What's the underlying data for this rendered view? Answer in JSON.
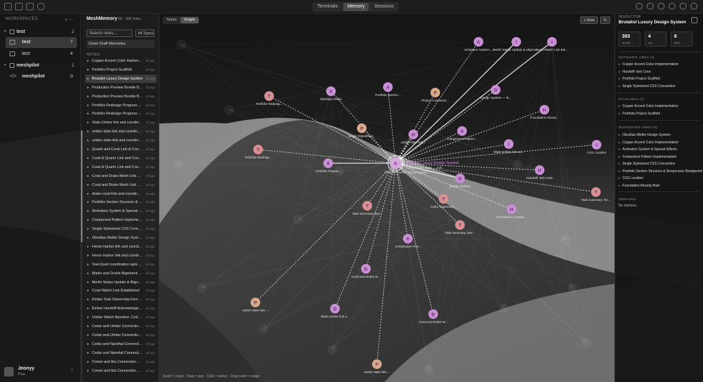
{
  "topbar": {
    "tabs": [
      {
        "label": "Terminals"
      },
      {
        "label": "Memory"
      },
      {
        "label": "Sessions"
      }
    ]
  },
  "workspaces": {
    "header": "WORKSPACES",
    "groups": [
      {
        "name": "test",
        "count": "2",
        "sessions": [
          {
            "name": "test",
            "count": "7"
          },
          {
            "name": "test",
            "count": "4"
          }
        ]
      },
      {
        "name": "meshpilot",
        "count": "1",
        "sessions": [
          {
            "name": "meshpilot",
            "count": "0"
          }
        ]
      }
    ],
    "user": {
      "name": "Jeonyy",
      "plan": "Plus"
    }
  },
  "notes_panel": {
    "title": "MeshMemory",
    "subtitle": "68 · 650 links",
    "search_placeholder": "Search notes...",
    "type_filter": "All Types",
    "clean_button": "Clean Draft Memories",
    "section": "NOTES",
    "items": [
      {
        "title": "Copper Accent Color Implement...",
        "age": "2d ago"
      },
      {
        "title": "Portfolio Project Scaffold",
        "age": "2d ago"
      },
      {
        "title": "Brutalist Luxury Design System",
        "age": "2d ago"
      },
      {
        "title": "Production Preview Bundle Buil...",
        "age": "2d ago"
      },
      {
        "title": "Production Preview Bundle Buil...",
        "age": "2d ago"
      },
      {
        "title": "Portfolio Redesign Progress — ...",
        "age": "2d ago"
      },
      {
        "title": "Portfolio Redesign Progress — ...",
        "age": "2d ago"
      },
      {
        "title": "Slate-Umber link and coordinati...",
        "age": "2d ago"
      },
      {
        "title": "umber slate link and coordinatio...",
        "age": "2d ago"
      },
      {
        "title": "umber-slate-link-and-coordinatio...",
        "age": "2d ago"
      },
      {
        "title": "Quartz and Coral Link & Coordi...",
        "age": "2d ago"
      },
      {
        "title": "Coral & Quartz Link and Coordi...",
        "age": "2d ago"
      },
      {
        "title": "Coral & Quartz Link and Coordi...",
        "age": "2d ago"
      },
      {
        "title": "Coral and Drake Mesh Link & 1...",
        "age": "2d ago"
      },
      {
        "title": "Coral and Drake Mesh Link & T...",
        "age": "2d ago"
      },
      {
        "title": "drake-coral-link-and-coordination",
        "age": "2d ago"
      },
      {
        "title": "Portfolio Section Structure & R...",
        "age": "2d ago"
      },
      {
        "title": "Animation System & Special Ef...",
        "age": "2d ago"
      },
      {
        "title": "Component Pattern Implementat...",
        "age": "2d ago"
      },
      {
        "title": "Single-Stylesheet CSS Conven...",
        "age": "2d ago"
      },
      {
        "title": "Obsidian Atelier Design System",
        "age": "2d ago"
      },
      {
        "title": "Heron-Harbor link and coordinati...",
        "age": "2d ago"
      },
      {
        "title": "Heron Harbor link and coordina...",
        "age": "2d ago"
      },
      {
        "title": "Teal-Quail coordination agreement",
        "age": "2d ago"
      },
      {
        "title": "Marlin and Ocelot Alignment  W...",
        "age": "2d ago"
      },
      {
        "title": "Merlin Status Update & Alignme...",
        "age": "2d ago"
      },
      {
        "title": "Coral Watch Link Established",
        "age": "2d ago"
      },
      {
        "title": "Ember Task Ownership from Me...",
        "age": "2d ago"
      },
      {
        "title": "Ember Handoff Acknowledged fr...",
        "age": "2d ago"
      },
      {
        "title": "Umber Watch Baseline: Cedar I...",
        "age": "2d ago"
      },
      {
        "title": "Cedar and Umber Connection E...",
        "age": "2d ago"
      },
      {
        "title": "Cedar and Umber Connection E...",
        "age": "2d ago"
      },
      {
        "title": "Cedar and Narwhal Connection ...",
        "age": "2d ago"
      },
      {
        "title": "Cedar and Narwhal Connection Esta...",
        "age": "2d ago"
      },
      {
        "title": "Comet and Ibis Connection Esta...",
        "age": "2d ago"
      },
      {
        "title": "Comet and Ibis Connection Esta...",
        "age": "2d ago"
      }
    ]
  },
  "graph": {
    "view_tabs": [
      {
        "label": "Notes"
      },
      {
        "label": "Graph"
      }
    ],
    "new_note_label": "+ Note",
    "hint": "Scroll = zoom · Drag = pan · Click = select · Drag node = nudge",
    "nodes": [
      {
        "letter": "A",
        "label": "Brutalist Luxury Design System",
        "color": "#d7a7e0",
        "center": true
      },
      {
        "letter": "A",
        "label": "Animation System ...",
        "color": "#c98fd4"
      },
      {
        "letter": "I",
        "label": "Merlin Status Update & Alignme...",
        "color": "#c98fd4"
      },
      {
        "letter": "I",
        "label": "Coral Watch Link Est...",
        "color": "#c98fd4"
      },
      {
        "letter": "A",
        "label": "Portfolio Section...",
        "color": "#c98fd4"
      },
      {
        "letter": "P",
        "label": "Project Connectio...",
        "color": "#d9a88a"
      },
      {
        "letter": "D",
        "label": "Design System — B...",
        "color": "#c98fd4"
      },
      {
        "letter": "A",
        "label": "Obsidian Atelier",
        "color": "#c98fd4"
      },
      {
        "letter": "T",
        "label": "Portfolio Redesig...",
        "color": "#d99090"
      },
      {
        "letter": "H",
        "label": "Foundation Alread...",
        "color": "#c98fd4"
      },
      {
        "letter": "P",
        "label": "Single-Stylesheet...",
        "color": "#d9a88a"
      },
      {
        "letter": "H",
        "label": "umber slate link...",
        "color": "#c98fd4"
      },
      {
        "letter": "A",
        "label": "Component Pattern...",
        "color": "#c98fd4"
      },
      {
        "letter": "I",
        "label": "Slate-Umber link an...",
        "color": "#c98fd4"
      },
      {
        "letter": "I",
        "label": "CSS Location",
        "color": "#c98fd4"
      },
      {
        "letter": "T",
        "label": "Portfolio Redesig...",
        "color": "#d99090"
      },
      {
        "letter": "A",
        "label": "Portfolio Project...",
        "color": "#c98fd4"
      },
      {
        "letter": "H",
        "label": "Handoff: test Crew",
        "color": "#c98fd4"
      },
      {
        "letter": "D",
        "label": "Design System",
        "color": "#c98fd4"
      },
      {
        "letter": "T",
        "label": "Color Implement...",
        "color": "#d99090"
      },
      {
        "letter": "T",
        "label": "Task Summary: Bro...",
        "color": "#d99090"
      },
      {
        "letter": "T",
        "label": "Task Summary: Bre...",
        "color": "#d99090"
      },
      {
        "letter": "H",
        "label": "Foundation Comple...",
        "color": "#c98fd4"
      },
      {
        "letter": "T",
        "label": "Task Summary: Re...",
        "color": "#d99090"
      },
      {
        "letter": "A",
        "label": "Architecture Pho...",
        "color": "#c98fd4"
      },
      {
        "letter": "D",
        "label": "Coral and Drake M...",
        "color": "#c98fd4"
      },
      {
        "letter": "P",
        "label": "umber-slate-link-...",
        "color": "#d9a88a"
      },
      {
        "letter": "D",
        "label": "Slate-Umber link a...",
        "color": "#c98fd4"
      },
      {
        "letter": "D",
        "label": "Coral and Drake M...",
        "color": "#c98fd4"
      },
      {
        "letter": "P",
        "label": "umber-slate-link-...",
        "color": "#d9a88a"
      }
    ],
    "center_labels": [
      "Brutalist Luxury Design System",
      "Component... style ... und...",
      "design-system"
    ]
  },
  "inspector": {
    "caption": "INSPECTOR",
    "note_title": "Brutalist Luxury Design System",
    "stats": [
      {
        "value": "393",
        "label": "words"
      },
      {
        "value": "4",
        "label": "out"
      },
      {
        "value": "6",
        "label": "links"
      }
    ],
    "outgoing_header": "OUTGOING LINKS (4)",
    "outgoing": [
      "Copper Accent Color Implementation",
      "Handoff: test Crew",
      "Portfolio Project Scaffold",
      "Single Stylesheet CSS Convention"
    ],
    "backlinks_header": "BACKLINKS (2)",
    "backlinks": [
      "Copper Accent Color Implementation",
      "Portfolio Project Scaffold"
    ],
    "suggested_header": "SUGGESTED LINKS (8)",
    "suggested": [
      "Obsidian Atelier Design System",
      "Copper Accent Color Implementation",
      "Animation System & Special Effects",
      "Component Pattern Implementation",
      "Single Stylesheet CSS Convention",
      "Portfolio Section Structure & Responsive Breakpoints",
      "CSS Location",
      "Foundation Already Built"
    ],
    "orphans_header": "ORPHANS",
    "orphans_text": "No orphans."
  }
}
